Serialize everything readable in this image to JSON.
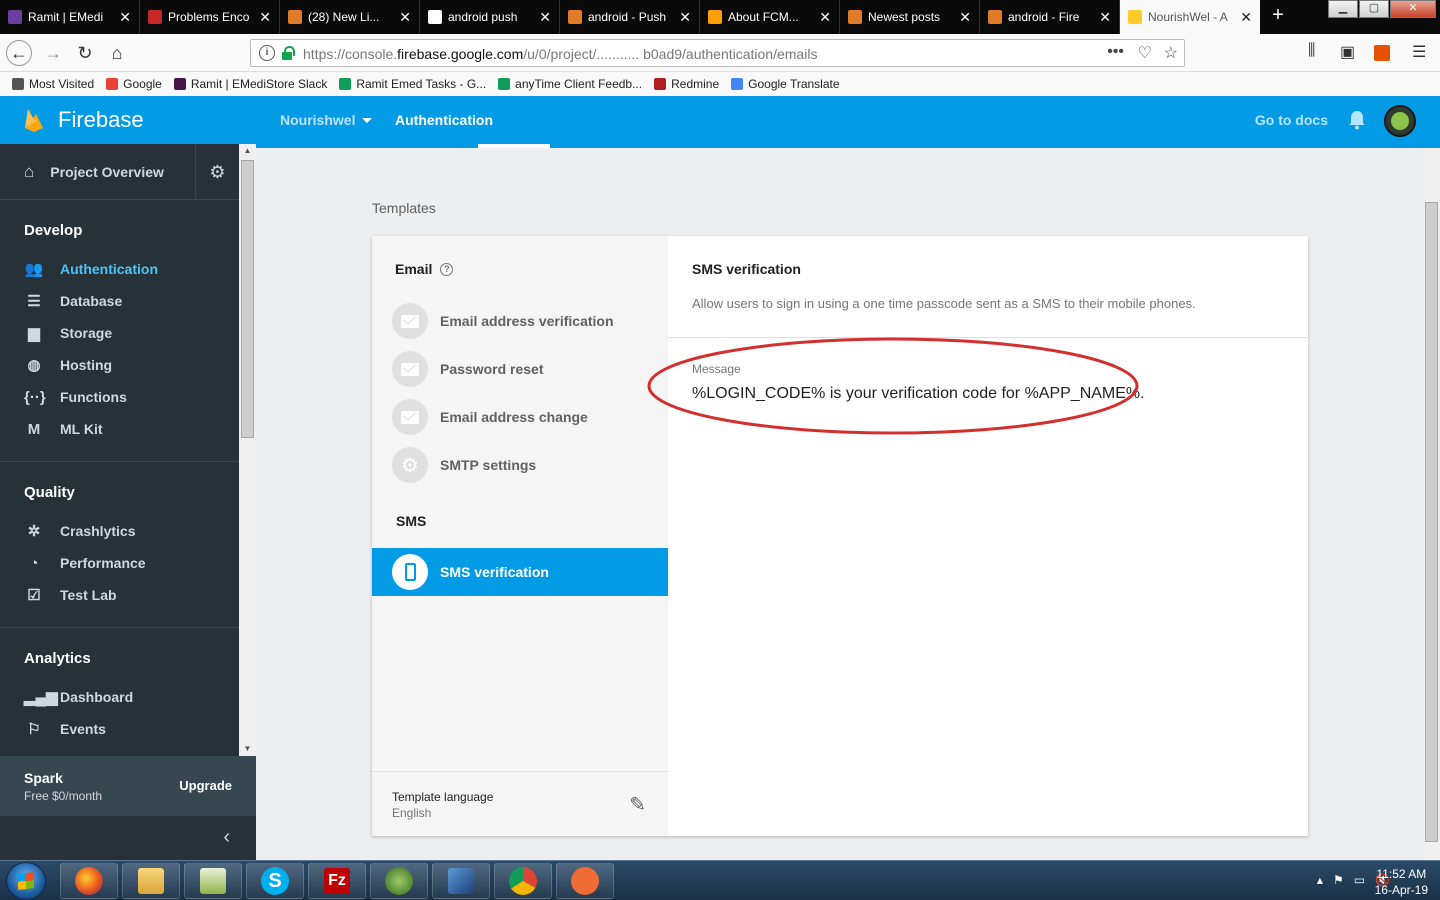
{
  "browser": {
    "tabs": [
      {
        "title": "Ramit | EMedi",
        "color": "#6a3fa0"
      },
      {
        "title": "Problems Enco",
        "color": "#c62828"
      },
      {
        "title": "(28) New Li...",
        "color": "#e07b2a"
      },
      {
        "title": "android push",
        "color": "#ffffff"
      },
      {
        "title": "android - Push",
        "color": "#e07b2a"
      },
      {
        "title": "About FCM...",
        "color": "#ffa000"
      },
      {
        "title": "Newest posts",
        "color": "#e07b2a"
      },
      {
        "title": "android - Fire",
        "color": "#e07b2a"
      },
      {
        "title": "NourishWel - A",
        "color": "#ffca28"
      }
    ],
    "url": {
      "prefix": "https://console.",
      "domain": "firebase.google.com",
      "path": "/u/0/project/",
      "masked": "...........",
      "suffix": "b0ad9/authentication/emails"
    },
    "bookmarks": [
      {
        "label": "Most Visited",
        "color": "#555555"
      },
      {
        "label": "Google",
        "color": "#ea4335"
      },
      {
        "label": "Ramit | EMediStore Slack",
        "color": "#4a154b"
      },
      {
        "label": "Ramit Emed Tasks - G...",
        "color": "#0f9d58"
      },
      {
        "label": "anyTime Client Feedb...",
        "color": "#0f9d58"
      },
      {
        "label": "Redmine",
        "color": "#b32024"
      },
      {
        "label": "Google Translate",
        "color": "#4285f4"
      }
    ]
  },
  "sidebar": {
    "brand": "Firebase",
    "project_overview": "Project Overview",
    "sections": [
      {
        "title": "Develop",
        "items": [
          {
            "label": "Authentication",
            "icon": "people-icon",
            "glyph": "👥",
            "active": true
          },
          {
            "label": "Database",
            "icon": "database-icon",
            "glyph": "☰",
            "active": false
          },
          {
            "label": "Storage",
            "icon": "storage-icon",
            "glyph": "▆",
            "active": false
          },
          {
            "label": "Hosting",
            "icon": "globe-icon",
            "glyph": "◍",
            "active": false
          },
          {
            "label": "Functions",
            "icon": "functions-icon",
            "glyph": "{··}",
            "active": false
          },
          {
            "label": "ML Kit",
            "icon": "mlkit-icon",
            "glyph": "M",
            "active": false
          }
        ]
      },
      {
        "title": "Quality",
        "items": [
          {
            "label": "Crashlytics",
            "icon": "crashlytics-icon",
            "glyph": "✲",
            "active": false
          },
          {
            "label": "Performance",
            "icon": "performance-icon",
            "glyph": "◔",
            "active": false
          },
          {
            "label": "Test Lab",
            "icon": "testlab-icon",
            "glyph": "☑",
            "active": false
          }
        ]
      },
      {
        "title": "Analytics",
        "items": [
          {
            "label": "Dashboard",
            "icon": "bar-chart-icon",
            "glyph": "▂▄▆",
            "active": false
          },
          {
            "label": "Events",
            "icon": "events-icon",
            "glyph": "⚐",
            "active": false
          }
        ]
      }
    ],
    "plan": {
      "name": "Spark",
      "price": "Free $0/month",
      "upgrade": "Upgrade"
    }
  },
  "header": {
    "project": "Nourishwel",
    "section": "Authentication",
    "docs": "Go to docs"
  },
  "main": {
    "page_label": "Templates",
    "left": {
      "email_heading": "Email",
      "email_templates": [
        {
          "label": "Email address verification",
          "icon": "envelope-icon"
        },
        {
          "label": "Password reset",
          "icon": "envelope-icon"
        },
        {
          "label": "Email address change",
          "icon": "envelope-icon"
        },
        {
          "label": "SMTP settings",
          "icon": "gear-icon"
        }
      ],
      "sms_heading": "SMS",
      "sms_item": "SMS verification",
      "language_label": "Template language",
      "language_value": "English"
    },
    "right": {
      "title": "SMS verification",
      "description": "Allow users to sign in using a one time passcode sent as a SMS to their mobile phones.",
      "message_label": "Message",
      "message_text": "%LOGIN_CODE% is your verification code for %APP_NAME%."
    }
  },
  "taskbar": {
    "time": "11:52 AM",
    "date": "16-Apr-19"
  }
}
